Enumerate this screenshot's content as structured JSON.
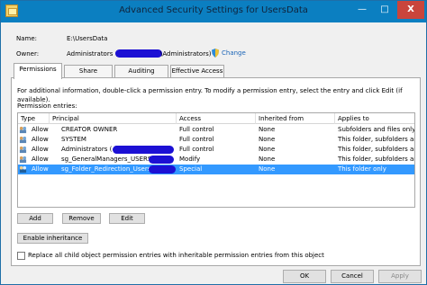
{
  "window": {
    "title": "Advanced Security Settings for UsersData",
    "minimize": "—",
    "maximize": "□",
    "close": "X"
  },
  "info": {
    "name_label": "Name:",
    "name_value": "E:\\UsersData",
    "owner_label": "Owner:",
    "owner_prefix": "Administrators (",
    "owner_suffix": "\\Administrators)",
    "change_link": "Change"
  },
  "tabs": [
    "Permissions",
    "Share",
    "Auditing",
    "Effective Access"
  ],
  "instructions": "For additional information, double-click a permission entry. To modify a permission entry, select the entry and click Edit (if available).",
  "entries_label": "Permission entries:",
  "table": {
    "headers": [
      "Type",
      "Principal",
      "Access",
      "Inherited from",
      "Applies to"
    ],
    "rows": [
      [
        "Allow",
        "CREATOR OWNER",
        "Full control",
        "None",
        "Subfolders and files only"
      ],
      [
        "Allow",
        "SYSTEM",
        "Full control",
        "None",
        "This folder, subfolders and"
      ],
      [
        "Allow",
        "Administrators (",
        "Full control",
        "None",
        "This folder, subfolders and"
      ],
      [
        "Allow",
        "sg_GeneralManagers_USERS",
        "Modify",
        "None",
        "This folder, subfolders and"
      ],
      [
        "Allow",
        "sg_Folder_Redirection_Users",
        "Special",
        "None",
        "This folder only"
      ]
    ]
  },
  "buttons": {
    "add": "Add",
    "remove": "Remove",
    "edit": "Edit",
    "enable_inheritance": "Enable inheritance",
    "ok": "OK",
    "cancel": "Cancel",
    "apply": "Apply"
  },
  "checkbox_label": "Replace all child object permission entries with inheritable permission entries from this object",
  "colors": {
    "title_bar": "#0b7fc1",
    "selection": "#3399ff",
    "redaction": "#1c10d4",
    "link": "#1b65b7"
  }
}
